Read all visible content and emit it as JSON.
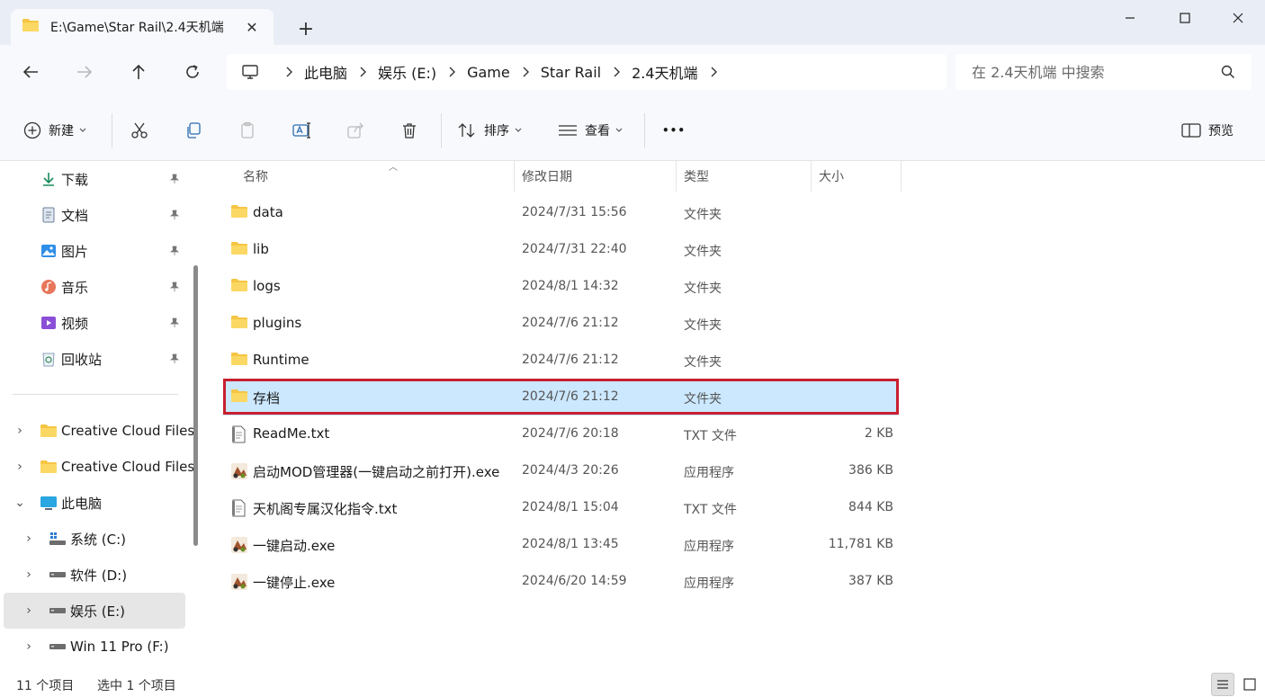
{
  "window": {
    "tab_title": "E:\\Game\\Star Rail\\2.4天机端",
    "tab_close": "✕",
    "new_tab": "+"
  },
  "nav": {
    "breadcrumbs": [
      "此电脑",
      "娱乐 (E:)",
      "Game",
      "Star Rail",
      "2.4天机端"
    ],
    "search_placeholder": "在 2.4天机端 中搜索"
  },
  "toolbar": {
    "new_label": "新建",
    "sort_label": "排序",
    "view_label": "查看",
    "more_label": "•••",
    "preview_label": "预览"
  },
  "sidebar": {
    "quick_access": [
      {
        "label": "下载",
        "icon": "download-icon"
      },
      {
        "label": "文档",
        "icon": "document-icon"
      },
      {
        "label": "图片",
        "icon": "pictures-icon"
      },
      {
        "label": "音乐",
        "icon": "music-icon"
      },
      {
        "label": "视频",
        "icon": "video-icon"
      },
      {
        "label": "回收站",
        "icon": "recycle-bin-icon"
      }
    ],
    "tree": [
      {
        "label": "Creative Cloud Files",
        "icon": "folder-icon",
        "expander": "›"
      },
      {
        "label": "Creative Cloud Files",
        "icon": "folder-icon",
        "expander": "›"
      },
      {
        "label": "此电脑",
        "icon": "computer-icon",
        "expander": "⌄"
      },
      {
        "label": "系统 (C:)",
        "icon": "system-drive-icon",
        "expander": "›"
      },
      {
        "label": "软件 (D:)",
        "icon": "drive-icon",
        "expander": "›"
      },
      {
        "label": "娱乐 (E:)",
        "icon": "drive-icon",
        "expander": "›"
      },
      {
        "label": "Win 11 Pro (F:)",
        "icon": "drive-icon",
        "expander": "›"
      }
    ]
  },
  "columns": {
    "name": "名称",
    "date": "修改日期",
    "type": "类型",
    "size": "大小"
  },
  "files": [
    {
      "name": "data",
      "date": "2024/7/31 15:56",
      "type": "文件夹",
      "size": "",
      "icon": "folder-icon"
    },
    {
      "name": "lib",
      "date": "2024/7/31 22:40",
      "type": "文件夹",
      "size": "",
      "icon": "folder-icon"
    },
    {
      "name": "logs",
      "date": "2024/8/1 14:32",
      "type": "文件夹",
      "size": "",
      "icon": "folder-icon"
    },
    {
      "name": "plugins",
      "date": "2024/7/6 21:12",
      "type": "文件夹",
      "size": "",
      "icon": "folder-icon"
    },
    {
      "name": "Runtime",
      "date": "2024/7/6 21:12",
      "type": "文件夹",
      "size": "",
      "icon": "folder-icon"
    },
    {
      "name": "存档",
      "date": "2024/7/6 21:12",
      "type": "文件夹",
      "size": "",
      "icon": "folder-icon",
      "selected": true
    },
    {
      "name": "ReadMe.txt",
      "date": "2024/7/6 20:18",
      "type": "TXT 文件",
      "size": "2 KB",
      "icon": "text-file-icon"
    },
    {
      "name": "启动MOD管理器(一键启动之前打开).exe",
      "date": "2024/4/3 20:26",
      "type": "应用程序",
      "size": "386 KB",
      "icon": "app-exe-icon"
    },
    {
      "name": "天机阁专属汉化指令.txt",
      "date": "2024/8/1 15:04",
      "type": "TXT 文件",
      "size": "844 KB",
      "icon": "text-file-icon"
    },
    {
      "name": "一键启动.exe",
      "date": "2024/8/1 13:45",
      "type": "应用程序",
      "size": "11,781 KB",
      "icon": "app-exe-icon"
    },
    {
      "name": "一键停止.exe",
      "date": "2024/6/20 14:59",
      "type": "应用程序",
      "size": "387 KB",
      "icon": "app-exe-icon"
    }
  ],
  "status": {
    "item_count": "11 个项目",
    "selected_count": "选中 1 个项目"
  },
  "colors": {
    "selection": "#cce8ff",
    "highlight_border": "#c8202e",
    "folder": "#f6c544",
    "chrome_bg": "#f7f9fc"
  }
}
